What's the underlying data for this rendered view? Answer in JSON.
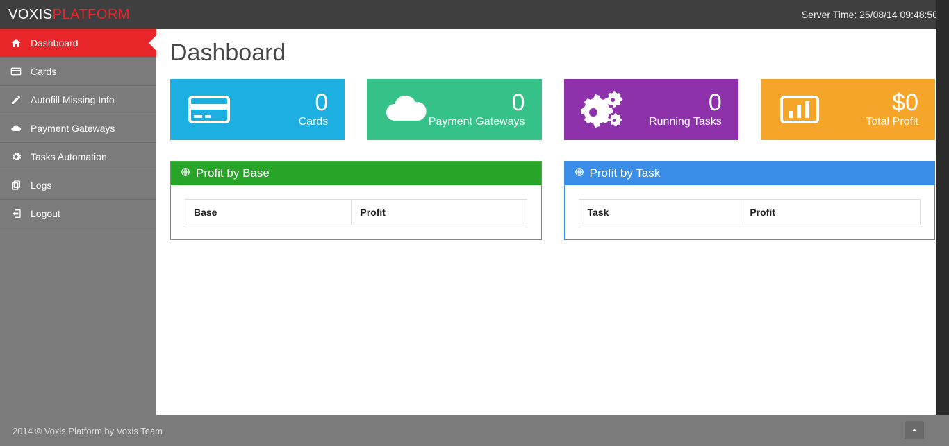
{
  "brand": {
    "part1": "VOXIS",
    "part2": "PLATFORM"
  },
  "server_time_prefix": "Server Time: ",
  "server_time": "25/08/14 09:48:50",
  "sidebar": {
    "items": [
      {
        "label": "Dashboard"
      },
      {
        "label": "Cards"
      },
      {
        "label": "Autofill Missing Info"
      },
      {
        "label": "Payment Gateways"
      },
      {
        "label": "Tasks Automation"
      },
      {
        "label": "Logs"
      },
      {
        "label": "Logout"
      }
    ]
  },
  "page_title": "Dashboard",
  "tiles": {
    "cards": {
      "value": "0",
      "label": "Cards"
    },
    "gateways": {
      "value": "0",
      "label": "Payment Gateways"
    },
    "tasks": {
      "value": "0",
      "label": "Running Tasks"
    },
    "profit": {
      "value": "$0",
      "label": "Total Profit"
    }
  },
  "panels": {
    "profit_by_base": {
      "title": "Profit by Base",
      "columns": [
        "Base",
        "Profit"
      ]
    },
    "profit_by_task": {
      "title": "Profit by Task",
      "columns": [
        "Task",
        "Profit"
      ]
    }
  },
  "footer": "2014 © Voxis Platform by Voxis Team"
}
